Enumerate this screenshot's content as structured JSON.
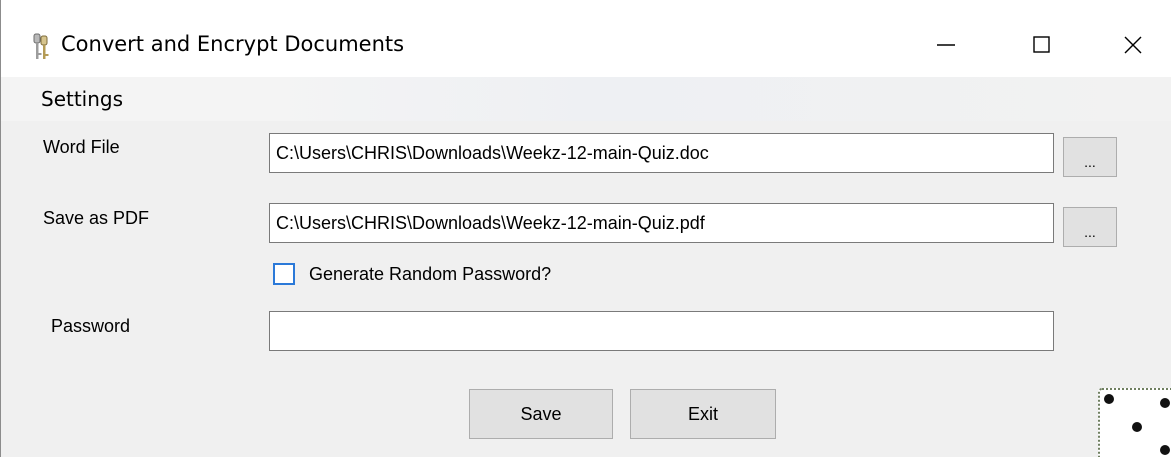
{
  "window": {
    "title": "Convert and Encrypt Documents",
    "controls": {
      "minimize": "minimize",
      "maximize": "maximize",
      "close": "close"
    }
  },
  "menu": {
    "items": [
      {
        "label": "Settings"
      }
    ]
  },
  "form": {
    "word_file": {
      "label": "Word File",
      "value": "C:\\Users\\CHRIS\\Downloads\\Weekz-12-main-Quiz.doc",
      "browse_label": "..."
    },
    "save_pdf": {
      "label": "Save as PDF",
      "value": "C:\\Users\\CHRIS\\Downloads\\Weekz-12-main-Quiz.pdf",
      "browse_label": "..."
    },
    "random_password": {
      "label": "Generate Random Password?",
      "checked": false
    },
    "password": {
      "label": "Password",
      "value": ""
    }
  },
  "actions": {
    "save_label": "Save",
    "exit_label": "Exit"
  },
  "icons": {
    "app": "keys-icon",
    "decoration": "dice-icon"
  },
  "colors": {
    "checkbox_border": "#2b79d8",
    "button_face": "#e1e1e1",
    "window_bg": "#f0f0f0"
  }
}
